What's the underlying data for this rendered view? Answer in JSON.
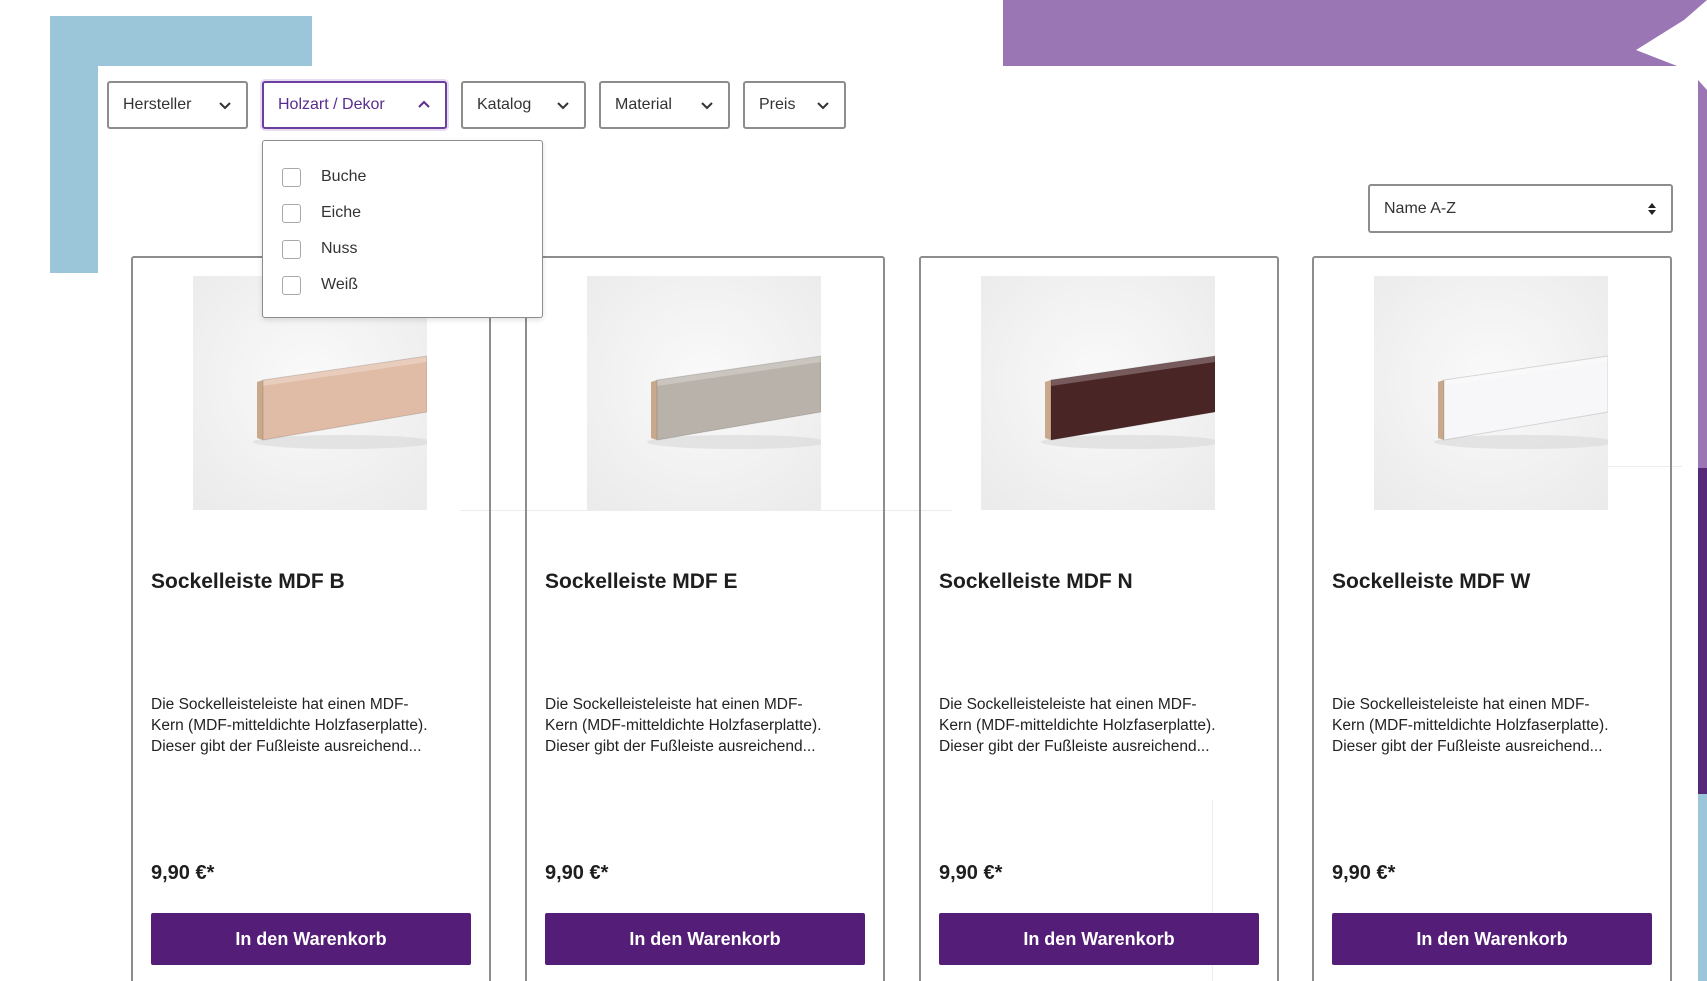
{
  "colors": {
    "accent": "#541d78",
    "active_border": "#6b3fa0",
    "deco_purple": "#9b76b4",
    "deco_blue": "#9bc6da"
  },
  "filters": [
    {
      "label": "Hersteller",
      "icon": "chevron-down-icon"
    },
    {
      "label": "Holzart / Dekor",
      "icon": "chevron-up-icon",
      "active": true
    },
    {
      "label": "Katalog",
      "icon": "chevron-down-icon"
    },
    {
      "label": "Material",
      "icon": "chevron-down-icon"
    },
    {
      "label": "Preis",
      "icon": "chevron-down-icon"
    }
  ],
  "dropdown": {
    "options": [
      "Buche",
      "Eiche",
      "Nuss",
      "Weiß"
    ]
  },
  "sort": {
    "value": "Name A-Z",
    "icon": "updown-arrows-icon"
  },
  "products": [
    {
      "title": "Sockelleiste MDF B",
      "desc_lines": [
        "Die Sockelleisteleiste hat einen MDF-",
        "Kern (MDF-mitteldichte Holzfaserplatte).",
        "Dieser gibt der Fußleiste ausreichend..."
      ],
      "price": "9,90 €*",
      "button": "In den Warenkorb",
      "color": "#e0bba6"
    },
    {
      "title": "Sockelleiste MDF E",
      "desc_lines": [
        "Die Sockelleisteleiste hat einen MDF-",
        "Kern (MDF-mitteldichte Holzfaserplatte).",
        "Dieser gibt der Fußleiste ausreichend..."
      ],
      "price": "9,90 €*",
      "button": "In den Warenkorb",
      "color": "#b8b2aa"
    },
    {
      "title": "Sockelleiste MDF N",
      "desc_lines": [
        "Die Sockelleisteleiste hat einen MDF-",
        "Kern (MDF-mitteldichte Holzfaserplatte).",
        "Dieser gibt der Fußleiste ausreichend..."
      ],
      "price": "9,90 €*",
      "button": "In den Warenkorb",
      "color": "#4a2526"
    },
    {
      "title": "Sockelleiste MDF W",
      "desc_lines": [
        "Die Sockelleisteleiste hat einen MDF-",
        "Kern (MDF-mitteldichte Holzfaserplatte).",
        "Dieser gibt der Fußleiste ausreichend..."
      ],
      "price": "9,90 €*",
      "button": "In den Warenkorb",
      "color": "#f7f7f9"
    }
  ]
}
